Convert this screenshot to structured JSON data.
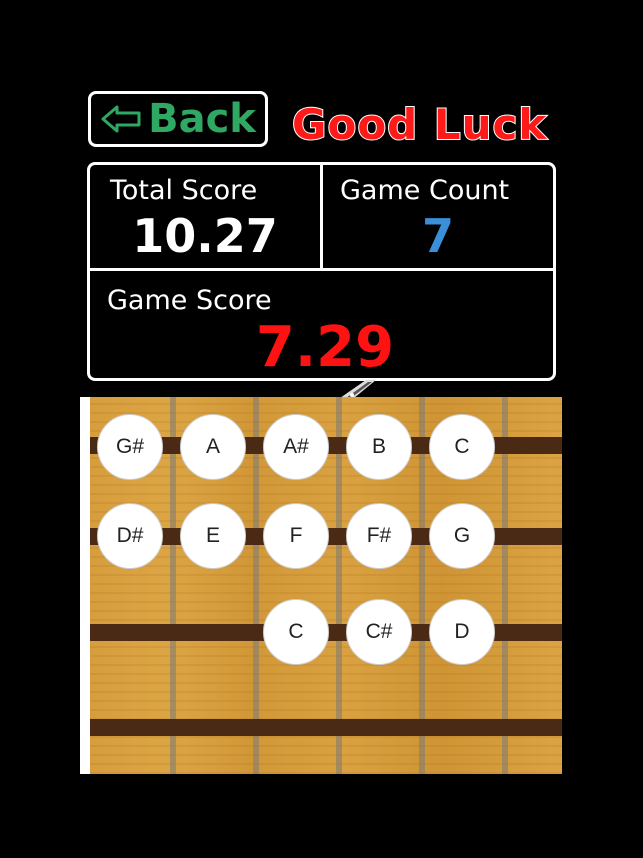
{
  "header": {
    "back_label": "Back",
    "status_text": "Good Luck"
  },
  "scores": {
    "total_score_label": "Total Score",
    "total_score_value": "10.27",
    "game_count_label": "Game Count",
    "game_count_value": "7",
    "game_score_label": "Game Score",
    "game_score_value": "7.29"
  },
  "fretboard": {
    "row1": [
      "G#",
      "A",
      "A#",
      "B",
      "C"
    ],
    "row2": [
      "D#",
      "E",
      "F",
      "F#",
      "G"
    ],
    "row3": [
      "C",
      "C#",
      "D"
    ]
  },
  "colors": {
    "back": "#2fa864",
    "good_luck": "#ff1a1a",
    "game_count": "#3b8ed8",
    "game_score": "#ff1212"
  }
}
